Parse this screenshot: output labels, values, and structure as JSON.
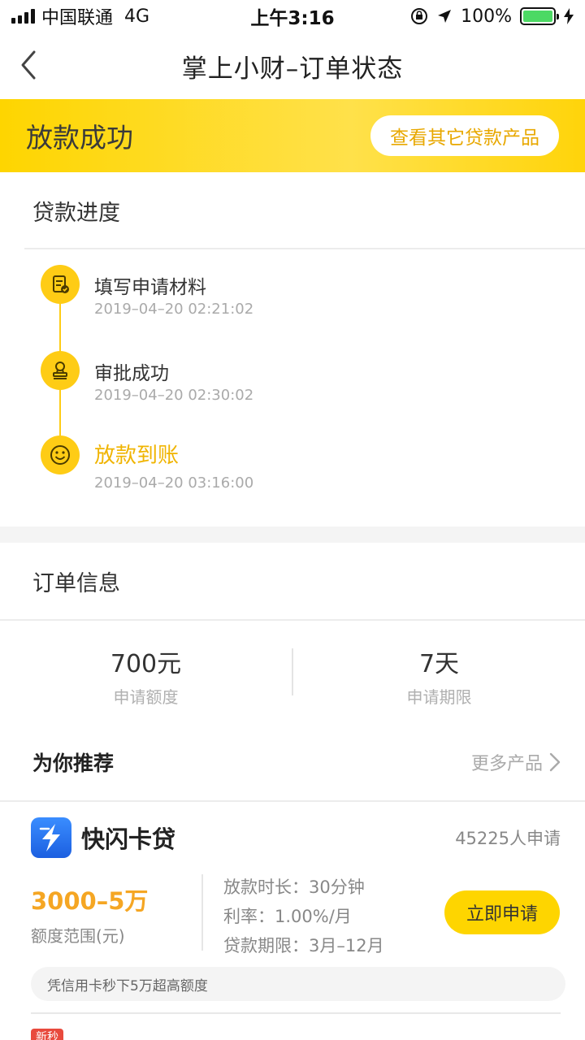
{
  "status_bar": {
    "carrier": "中国联通",
    "network": "4G",
    "time": "上午3:16",
    "battery": "100%"
  },
  "nav": {
    "title": "掌上小财–订单状态"
  },
  "banner": {
    "title": "放款成功",
    "button": "查看其它贷款产品"
  },
  "progress": {
    "title": "贷款进度",
    "steps": [
      {
        "title": "填写申请材料",
        "time": "2019–04–20 02:21:02",
        "icon": "document-check-icon"
      },
      {
        "title": "审批成功",
        "time": "2019–04–20 02:30:02",
        "icon": "stamp-icon"
      },
      {
        "title": "放款到账",
        "time": "2019–04–20 03:16:00",
        "icon": "smile-icon"
      }
    ]
  },
  "order": {
    "title": "订单信息",
    "amount_value": "700元",
    "amount_label": "申请额度",
    "term_value": "7天",
    "term_label": "申请期限"
  },
  "recommend": {
    "title": "为你推荐",
    "more": "更多产品"
  },
  "product": {
    "name": "快闪卡贷",
    "applicants": "45225人申请",
    "amount_range": "3000–5万",
    "amount_label": "额度范围(元)",
    "details": [
      "放款时长：30分钟",
      "利率：1.00%/月",
      "贷款期限：3月–12月"
    ],
    "apply": "立即申请",
    "tip": "凭信用卡秒下5万超高额度"
  },
  "next_product": {
    "badge": "新秒"
  },
  "colors": {
    "brand_yellow": "#fed500",
    "accent_orange": "#f5a623"
  }
}
